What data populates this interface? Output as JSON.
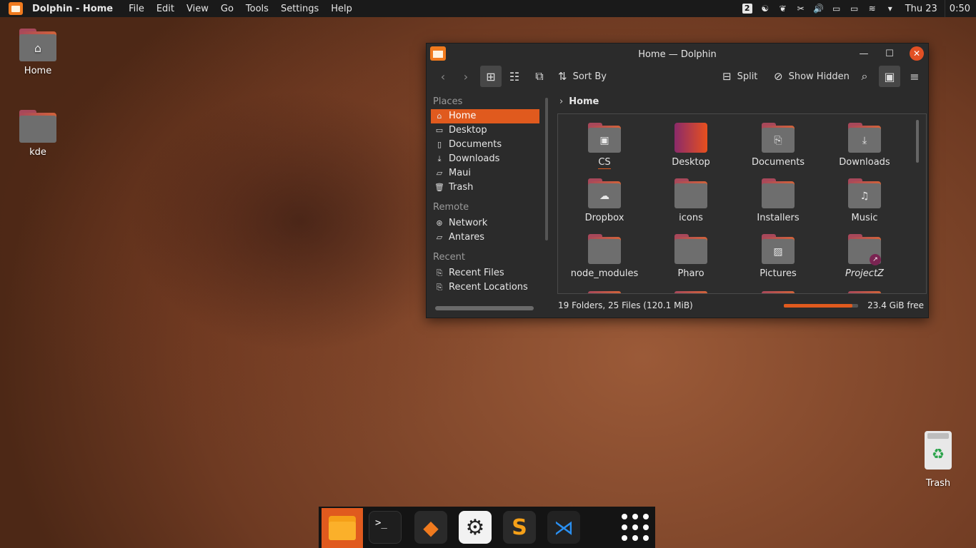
{
  "topbar": {
    "app_title": "Dolphin - Home",
    "menu": [
      "File",
      "Edit",
      "View",
      "Go",
      "Tools",
      "Settings",
      "Help"
    ],
    "workspace": "2",
    "day": "Thu 23",
    "time": "0:50"
  },
  "desktop": {
    "icons": [
      {
        "label": "Home"
      },
      {
        "label": "kde"
      }
    ],
    "trash_label": "Trash"
  },
  "window": {
    "title": "Home — Dolphin",
    "toolbar": {
      "sort_by": "Sort By",
      "split": "Split",
      "show_hidden": "Show Hidden"
    },
    "places": {
      "places_header": "Places",
      "places": [
        "Home",
        "Desktop",
        "Documents",
        "Downloads",
        "Maui",
        "Trash"
      ],
      "remote_header": "Remote",
      "remote": [
        "Network",
        "Antares"
      ],
      "recent_header": "Recent",
      "recent": [
        "Recent Files",
        "Recent Locations"
      ]
    },
    "breadcrumb": "Home",
    "items": [
      "CS",
      "Desktop",
      "Documents",
      "Downloads",
      "Dropbox",
      "icons",
      "Installers",
      "Music",
      "node_modules",
      "Pharo",
      "Pictures",
      "ProjectZ"
    ],
    "status": "19 Folders, 25 Files (120.1 MiB)",
    "free_space": "23.4 GiB free",
    "disk_used_fraction": 0.92
  },
  "dock": {
    "apps": [
      "files-icon",
      "terminal-icon",
      "gitkraken-icon",
      "settings-icon",
      "sublime-icon",
      "vscode-icon",
      "app-grid-icon"
    ]
  },
  "colors": {
    "accent": "#e05a1e",
    "panel": "#1a1a1a",
    "window_bg": "#2b2b2b"
  }
}
